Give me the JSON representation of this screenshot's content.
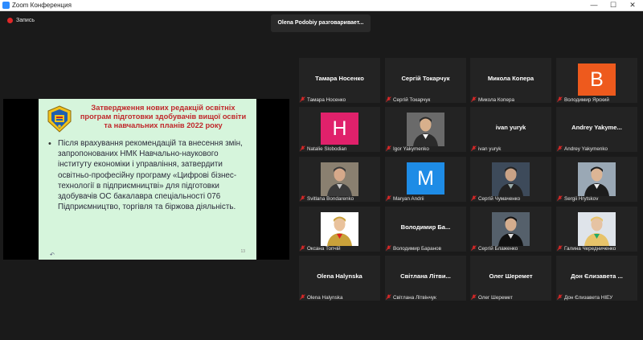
{
  "window": {
    "title": "Zoom Конференция",
    "minimize": "—",
    "maximize": "☐",
    "close": "✕"
  },
  "recording": {
    "label": "Запись"
  },
  "speaker_banner": "Olena Podobiy разговаривает...",
  "slide": {
    "title": "Затвердження нових редакцій освітніх програм підготовки здобувачів вищої освіти та навчальних планів 2022 року",
    "bullet": "•",
    "body": "Після врахування рекомендацій та внесення змін, запропонованих НМК Навчально-наукового інституту економіки і управління, затвердити освітньо-професійну програму «Цифрові бізнес-технології в підприємництві» для підготовки здобувачів ОС бакалавра спеціальності 076 Підприємництво, торгівля та біржова діяльність.",
    "page_num": "13",
    "nav_icon": "↶"
  },
  "participants": [
    {
      "name": "Тамара Носенко",
      "label": "Тамара Носенко",
      "type": "name",
      "muted": true
    },
    {
      "name": "Сергій Токарчук",
      "label": "Сергій Токарчук",
      "type": "name",
      "muted": true
    },
    {
      "name": "Микола Копера",
      "label": "Микола Копера",
      "type": "name",
      "muted": true
    },
    {
      "initial": "В",
      "label": "Володимир Ярский",
      "type": "avatar",
      "color": "#ee5a1d",
      "muted": true
    },
    {
      "initial": "H",
      "label": "Natalie Slobodian",
      "type": "avatar",
      "color": "#e0216b",
      "muted": true
    },
    {
      "label": "Igor Yakymenko",
      "type": "photo",
      "muted": true
    },
    {
      "name": "ivan yuryk",
      "label": "ivan yuryk",
      "type": "name",
      "muted": true
    },
    {
      "name": "Andrey  Yakyme...",
      "label": "Andrey Yakymenko",
      "type": "name",
      "muted": true
    },
    {
      "label": "Svitlana Bondarenko",
      "type": "photo",
      "muted": true
    },
    {
      "initial": "M",
      "label": "Maryan Andrii",
      "type": "avatar",
      "color": "#1e8ce6",
      "muted": true
    },
    {
      "label": "Сергій Чумаченко",
      "type": "photo",
      "muted": true
    },
    {
      "label": "Sergii Hrytskov",
      "type": "photo",
      "muted": true
    },
    {
      "label": "Оксана Топчій",
      "type": "photo",
      "muted": true
    },
    {
      "name": "Володимир  Ба...",
      "label": "Володимир Баранов",
      "type": "name",
      "muted": true
    },
    {
      "label": "Сергій Блаженко",
      "type": "photo",
      "muted": true
    },
    {
      "label": "Галина Чередниченко",
      "type": "photo",
      "muted": true
    },
    {
      "name": "Olena Halynska",
      "label": "Olena Halynska",
      "type": "name",
      "muted": true
    },
    {
      "name": "Світлана Літви...",
      "label": "Світлана Літвінчук",
      "type": "name",
      "muted": true
    },
    {
      "name": "Олег Шеремет",
      "label": "Олег Шеремет",
      "type": "name",
      "muted": true
    },
    {
      "name": "Дон Єлизавета ...",
      "label": "Дон Єлизавета НІЕУ",
      "type": "name",
      "muted": true
    }
  ]
}
